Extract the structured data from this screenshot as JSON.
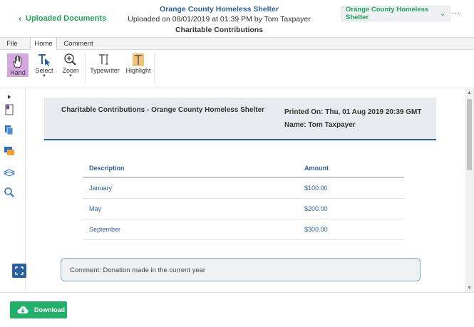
{
  "header": {
    "back_label": "Uploaded Documents",
    "org_name": "Orange County Homeless Shelter",
    "uploaded_info": "Uploaded on 08/01/2019 at 01:39 PM by Tom Taxpayer",
    "doc_title": "Charitable Contributions",
    "org_select_value": "Orange County Homeless Shelter",
    "more_label": "..."
  },
  "menu": {
    "tabs": [
      {
        "label": "File"
      },
      {
        "label": "Home"
      },
      {
        "label": "Comment"
      }
    ],
    "active": "Home"
  },
  "toolbar": {
    "hand_label": "Hand",
    "select_label": "Select",
    "zoom_label": "Zoom",
    "typewriter_label": "Typewriter",
    "highlight_label": "Highlight"
  },
  "sidebar": {
    "icons": [
      "expand-arrow-icon",
      "bookmark-icon",
      "pages-icon",
      "comments-icon",
      "layers-icon",
      "search-icon"
    ]
  },
  "document": {
    "title": "Charitable Contributions - Orange County Homeless Shelter",
    "printed_on": "Printed On: Thu, 01 Aug 2019 20:39 GMT",
    "name": "Name: Tom Taxpayer",
    "table": {
      "headers": [
        "Description",
        "Amount"
      ],
      "rows": [
        {
          "description": "January",
          "amount": "$100.00"
        },
        {
          "description": "May",
          "amount": "$200.00"
        },
        {
          "description": "September",
          "amount": "$300.00"
        }
      ]
    },
    "comment": "Comment: Donation made in the current year"
  },
  "footer": {
    "download_label": "Download"
  },
  "colors": {
    "accent_green": "#1fa35b",
    "brand_blue": "#2a5f9e",
    "hand_active": "#d4a8df"
  }
}
